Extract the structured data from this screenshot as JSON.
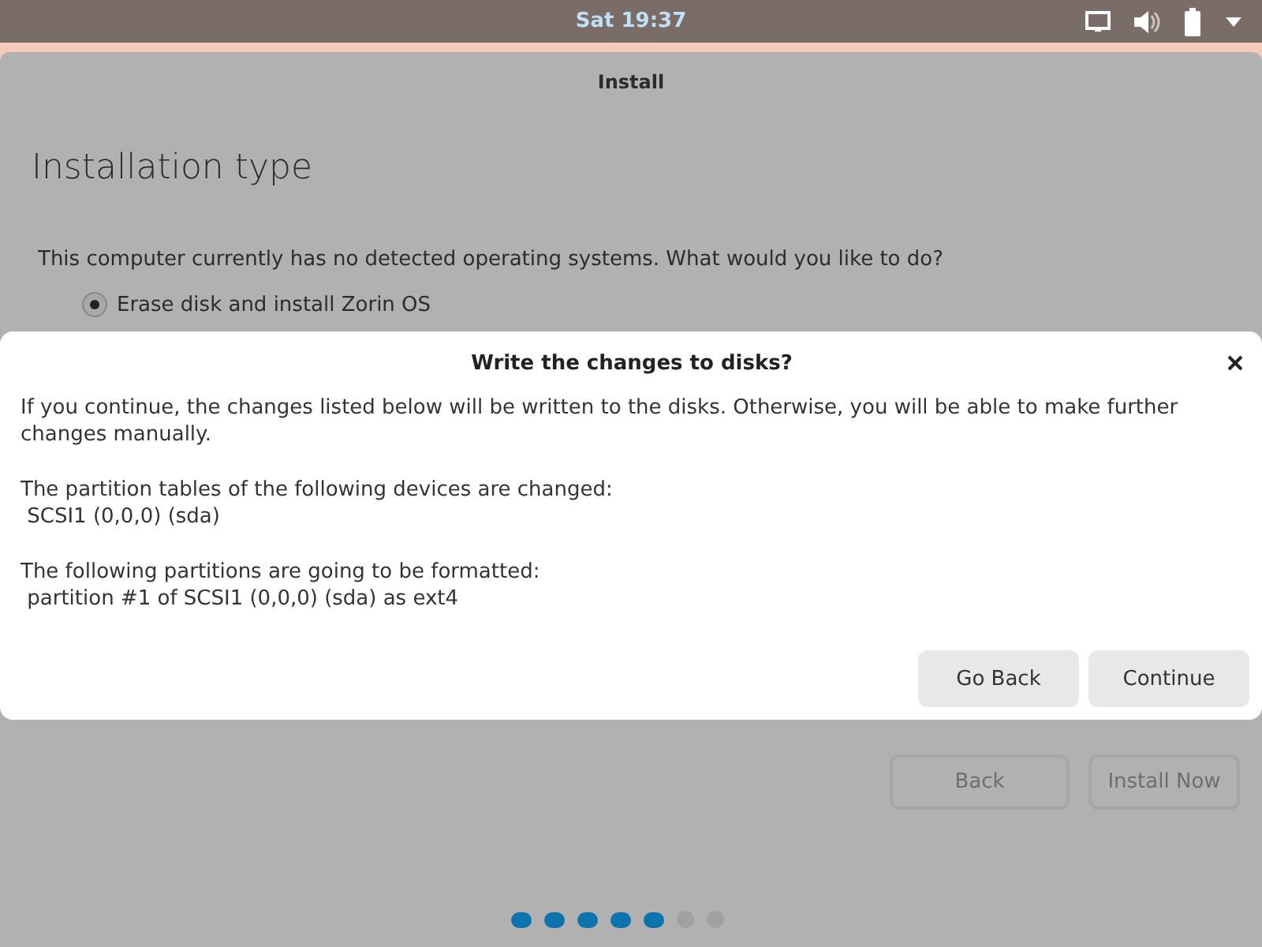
{
  "top_bar": {
    "clock": "Sat 19:37"
  },
  "window": {
    "title": "Install",
    "heading": "Installation type",
    "question": "This computer currently has no detected operating systems. What would you like to do?",
    "options": [
      {
        "label": "Erase disk and install Zorin OS",
        "selected": true
      }
    ],
    "buttons": [
      {
        "label": "Back"
      },
      {
        "label": "Install Now"
      }
    ],
    "steps": [
      {
        "done": true
      },
      {
        "done": true
      },
      {
        "done": true
      },
      {
        "done": true
      },
      {
        "done": true
      },
      {
        "done": false
      },
      {
        "done": false
      }
    ]
  },
  "dialog": {
    "title": "Write the changes to disks?",
    "paragraphs": [
      [
        "If you continue, the changes listed below will be written to the disks. Otherwise, you will be able to make further changes manually."
      ],
      [
        "The partition tables of the following devices are changed:",
        " SCSI1 (0,0,0) (sda)"
      ],
      [
        "The following partitions are going to be formatted:",
        " partition #1 of SCSI1 (0,0,0) (sda) as ext4"
      ]
    ],
    "buttons": [
      {
        "label": "Go Back"
      },
      {
        "label": "Continue"
      }
    ]
  }
}
